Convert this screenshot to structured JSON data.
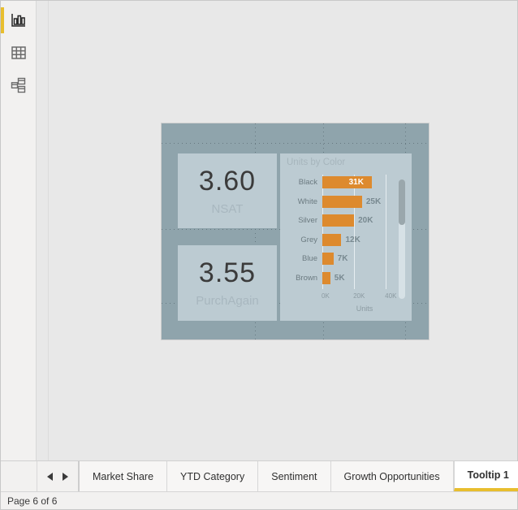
{
  "sidebar": {
    "items": [
      {
        "name": "report-view",
        "icon": "bar-chart-icon",
        "active": true
      },
      {
        "name": "data-view",
        "icon": "table-grid-icon",
        "active": false
      },
      {
        "name": "model-view",
        "icon": "relationship-model-icon",
        "active": false
      }
    ],
    "accent_color": "#e8be2e"
  },
  "canvas": {
    "background_color": "#8fa4ac",
    "kpi_cards": [
      {
        "value": "3.60",
        "label": "NSAT"
      },
      {
        "value": "3.55",
        "label": "PurchAgain"
      }
    ]
  },
  "chart_data": {
    "type": "bar",
    "title": "Units by Color",
    "orientation": "horizontal",
    "categories": [
      "Black",
      "White",
      "Silver",
      "Grey",
      "Blue",
      "Brown"
    ],
    "values": [
      31000,
      25000,
      20000,
      12000,
      7000,
      5000
    ],
    "data_labels": [
      "31K",
      "25K",
      "20K",
      "12K",
      "7K",
      "5K"
    ],
    "label_position": [
      "inside",
      "outside",
      "outside",
      "outside",
      "outside",
      "outside"
    ],
    "xlabel": "Units",
    "ylabel": "",
    "xlim": [
      0,
      44000
    ],
    "xticks": [
      0,
      20000,
      40000
    ],
    "xticklabels": [
      "0K",
      "20K",
      "40K"
    ],
    "grid": true,
    "legend": false,
    "series_color": "#dd8a2e",
    "inside_label_color": "#ffffff",
    "outside_label_color": "#788990"
  },
  "tabbar": {
    "prev_label": "previous-page",
    "next_label": "next-page",
    "tabs": [
      {
        "label": "Market Share",
        "active": false
      },
      {
        "label": "YTD Category",
        "active": false
      },
      {
        "label": "Sentiment",
        "active": false
      },
      {
        "label": "Growth Opportunities",
        "active": false
      },
      {
        "label": "Tooltip 1",
        "active": true
      }
    ]
  },
  "statusbar": {
    "page_indicator": "Page 6 of 6"
  }
}
